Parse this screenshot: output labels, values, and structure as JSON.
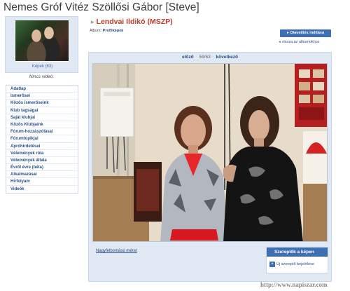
{
  "header": {
    "title": "Nemes Gróf Vitéz Szöllősi Gábor [Steve]"
  },
  "profile": {
    "photos_link": "Képek (63)",
    "no_video": "Nincs videó."
  },
  "sidebar": {
    "items": [
      {
        "label": "Adatlap"
      },
      {
        "label": "Ismerősei"
      },
      {
        "label": "Közös ismerőseink"
      },
      {
        "label": "Klub tagságai"
      },
      {
        "label": "Saját klubjai"
      },
      {
        "label": "Közös Klubjaink"
      },
      {
        "label": "Fórum-hozzászólásai"
      },
      {
        "label": "Fórumtopikjai"
      },
      {
        "label": "Apróhirdetései"
      },
      {
        "label": "Vélemények róla"
      },
      {
        "label": "Vélemények általa"
      },
      {
        "label": "Évről évre (béta)"
      },
      {
        "label": "Alkalmazásai"
      },
      {
        "label": "Hírfolyam"
      },
      {
        "label": "Videók"
      }
    ]
  },
  "album": {
    "photo_title": "Lendvai Ildikó (MSZP)",
    "album_prefix": "Album:",
    "album_name": "Profilképek",
    "slideshow_label": "Diavetítés indítása",
    "back_label": "vissza az albumokhoz"
  },
  "pager": {
    "prev_label": "előző",
    "count": "59/63",
    "next_label": "következő"
  },
  "photo": {
    "hires_label": "Nagyfelbontású méret"
  },
  "actors": {
    "title": "Szereplők a képen",
    "add_label": "Új szereplő bejelölése"
  },
  "watermark": "http://www.napiszar.com"
}
